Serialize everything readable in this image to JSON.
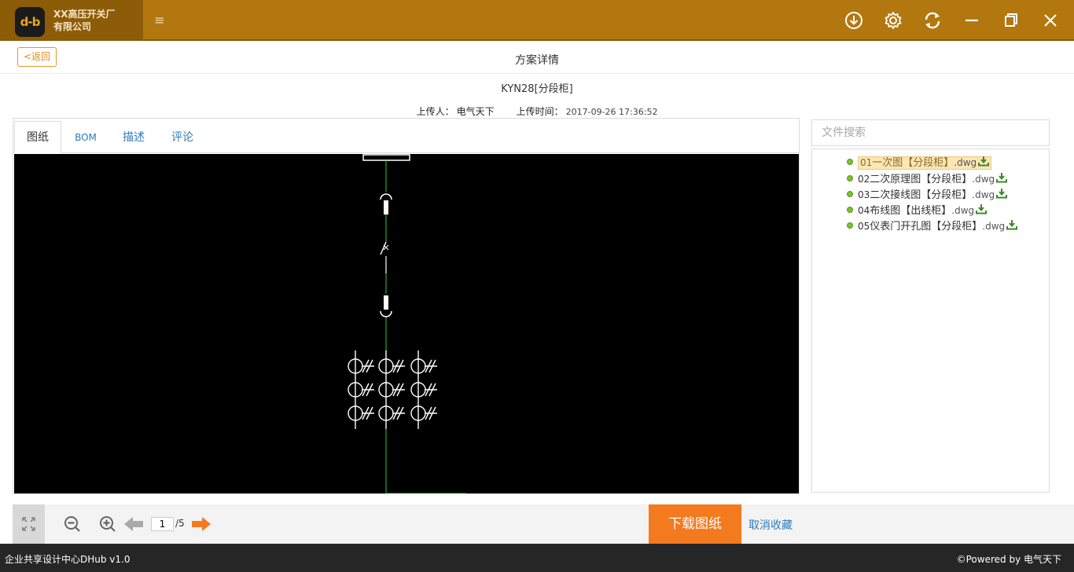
{
  "app": {
    "logo_text": "d-b",
    "company_line1": "XX高压开关厂",
    "company_line2": "有限公司"
  },
  "header": {
    "back_label": "<返回",
    "page_title": "方案详情",
    "plan_name": "KYN28[分段柜]",
    "uploader_label": "上传人：",
    "uploader": "电气天下",
    "upload_time_label": "上传时间：",
    "upload_time": "2017-09-26 17:36:52"
  },
  "tabs": [
    {
      "label": "图纸",
      "active": true
    },
    {
      "label": "BOM",
      "active": false
    },
    {
      "label": "描述",
      "active": false
    },
    {
      "label": "评论",
      "active": false
    }
  ],
  "search": {
    "placeholder": "文件搜索"
  },
  "files": [
    {
      "num": "01",
      "name": "一次图【分段柜】",
      "ext": ".dwg",
      "selected": true
    },
    {
      "num": "02",
      "name": "二次原理图【分段柜】",
      "ext": ".dwg",
      "selected": false
    },
    {
      "num": "03",
      "name": "二次接线图【分段柜】",
      "ext": ".dwg",
      "selected": false
    },
    {
      "num": "04",
      "name": "布线图【出线柜】",
      "ext": ".dwg",
      "selected": false
    },
    {
      "num": "05",
      "name": "仪表门开孔图【分段柜】",
      "ext": ".dwg",
      "selected": false
    }
  ],
  "toolbar": {
    "current_page": "1",
    "total_pages": "/5",
    "download_label": "下载图纸",
    "unfavorite_label": "取消收藏"
  },
  "status": {
    "left": "企业共享设计中心DHub v1.0",
    "right": "©Powered by 电气天下"
  },
  "colors": {
    "titlebar": "#b3770f",
    "accent_orange": "#f47a20",
    "link_blue": "#2b7bbd",
    "canvas_bg": "#000000",
    "wire_green": "#3cc33c"
  },
  "icons": [
    "download-icon",
    "settings-icon",
    "refresh-icon",
    "minimize-icon",
    "restore-icon",
    "close-icon",
    "menu-icon",
    "fullscreen-icon",
    "zoom-out-icon",
    "zoom-in-icon",
    "prev-page-icon",
    "next-page-icon",
    "file-download-icon",
    "file-dot-icon"
  ]
}
